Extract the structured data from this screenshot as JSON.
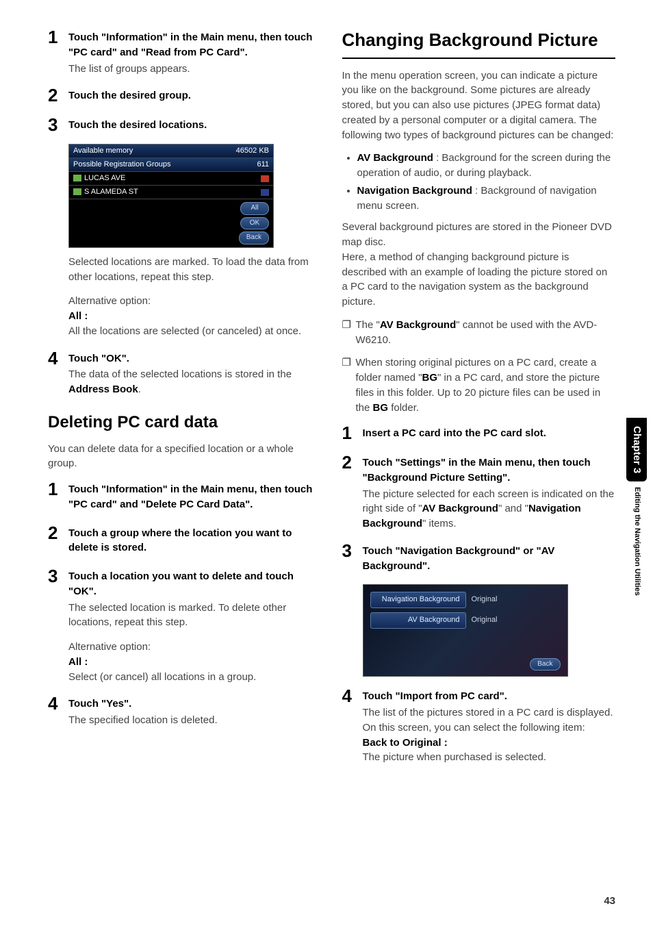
{
  "left": {
    "steps_top": [
      {
        "num": "1",
        "title": "Touch \"Information\" in the Main menu, then touch \"PC card\" and \"Read from PC Card\".",
        "text": "The list of groups appears."
      },
      {
        "num": "2",
        "title": "Touch the desired group.",
        "text": ""
      },
      {
        "num": "3",
        "title": "Touch the desired locations.",
        "text": ""
      }
    ],
    "shot1": {
      "mem_label": "Available memory",
      "mem_value": "46502 KB",
      "groups_label": "Possible Registration Groups",
      "groups_value": "611",
      "loc1": "LUCAS AVE",
      "loc2": "S ALAMEDA ST",
      "btn_all": "All",
      "btn_ok": "OK",
      "btn_back": "Back"
    },
    "after_shot1": {
      "selected_text": "Selected locations are marked. To load the data from other locations, repeat this step.",
      "alt_label": "Alternative option:",
      "all_label": "All :",
      "all_text": "All the locations are selected (or canceled) at once."
    },
    "step4a": {
      "num": "4",
      "title": "Touch \"OK\".",
      "text_pre": "The data of the selected locations is stored in the ",
      "text_bold": "Address Book",
      "text_post": "."
    },
    "section_delete": "Deleting PC card data",
    "delete_intro": "You can delete data for a specified location or a whole group.",
    "steps_delete": [
      {
        "num": "1",
        "title": "Touch \"Information\" in the Main menu, then touch \"PC card\" and \"Delete PC Card Data\".",
        "text": ""
      },
      {
        "num": "2",
        "title": "Touch a group where the location you want to delete is stored.",
        "text": ""
      },
      {
        "num": "3",
        "title": "Touch a location you want to delete and touch \"OK\".",
        "text": "The selected location is marked. To delete other locations, repeat this step."
      }
    ],
    "delete_alt": {
      "alt_label": "Alternative option:",
      "all_label": "All :",
      "all_text": "Select (or cancel) all locations in a group."
    },
    "step4b": {
      "num": "4",
      "title": "Touch \"Yes\".",
      "text": "The specified location is deleted."
    }
  },
  "right": {
    "heading": "Changing Background Picture",
    "intro": "In the menu operation screen, you can indicate a picture you like on the background. Some pictures are already stored, but you can also use pictures (JPEG format data) created by a personal computer or a digital camera. The following two types of background pictures can be changed:",
    "bullets": {
      "b1_bold": "AV Background",
      "b1_text": " : Background for the screen during the operation of audio, or during playback.",
      "b2_bold": "Navigation Background",
      "b2_text": " : Background of navigation menu screen."
    },
    "after_bullets": "Several background pictures are stored in the Pioneer DVD map disc.\nHere, a method of changing background picture is described with an example of loading the picture stored on a PC card to the navigation system as the background picture.",
    "note1_pre": "The \"",
    "note1_bold": "AV Background",
    "note1_post": "\" cannot be used with the AVD-W6210.",
    "note2_pre": "When storing original pictures on a PC card, create a folder named \"",
    "note2_bold1": "BG",
    "note2_mid": "\" in a PC card, and store the picture files in this folder. Up to 20 picture files can be used in the ",
    "note2_bold2": "BG",
    "note2_post": " folder.",
    "steps": [
      {
        "num": "1",
        "title": "Insert a PC card into the PC card slot.",
        "text": ""
      },
      {
        "num": "2",
        "title": "Touch \"Settings\" in the Main menu, then touch \"Background Picture Setting\".",
        "text_pre": "The picture selected for each screen is indicated on the right side of \"",
        "text_b1": "AV Background",
        "text_mid": "\" and \"",
        "text_b2": "Navigation Background",
        "text_post": "\" items."
      },
      {
        "num": "3",
        "title": "Touch \"Navigation Background\" or \"AV Background\".",
        "text": ""
      }
    ],
    "shot2": {
      "nav_btn": "Navigation Background",
      "nav_val": "Original",
      "av_btn": "AV Background",
      "av_val": "Original",
      "back": "Back"
    },
    "step4": {
      "num": "4",
      "title": "Touch \"Import from PC card\".",
      "text1": "The list of the pictures stored in a PC card is displayed.",
      "text2": "On this screen, you can select the following item:",
      "back_label": "Back to Original :",
      "back_text": "The picture when purchased is selected."
    }
  },
  "sidetab": {
    "chapter": "Chapter 3",
    "subtitle": "Editing the Navigation Utilities"
  },
  "page_number": "43"
}
